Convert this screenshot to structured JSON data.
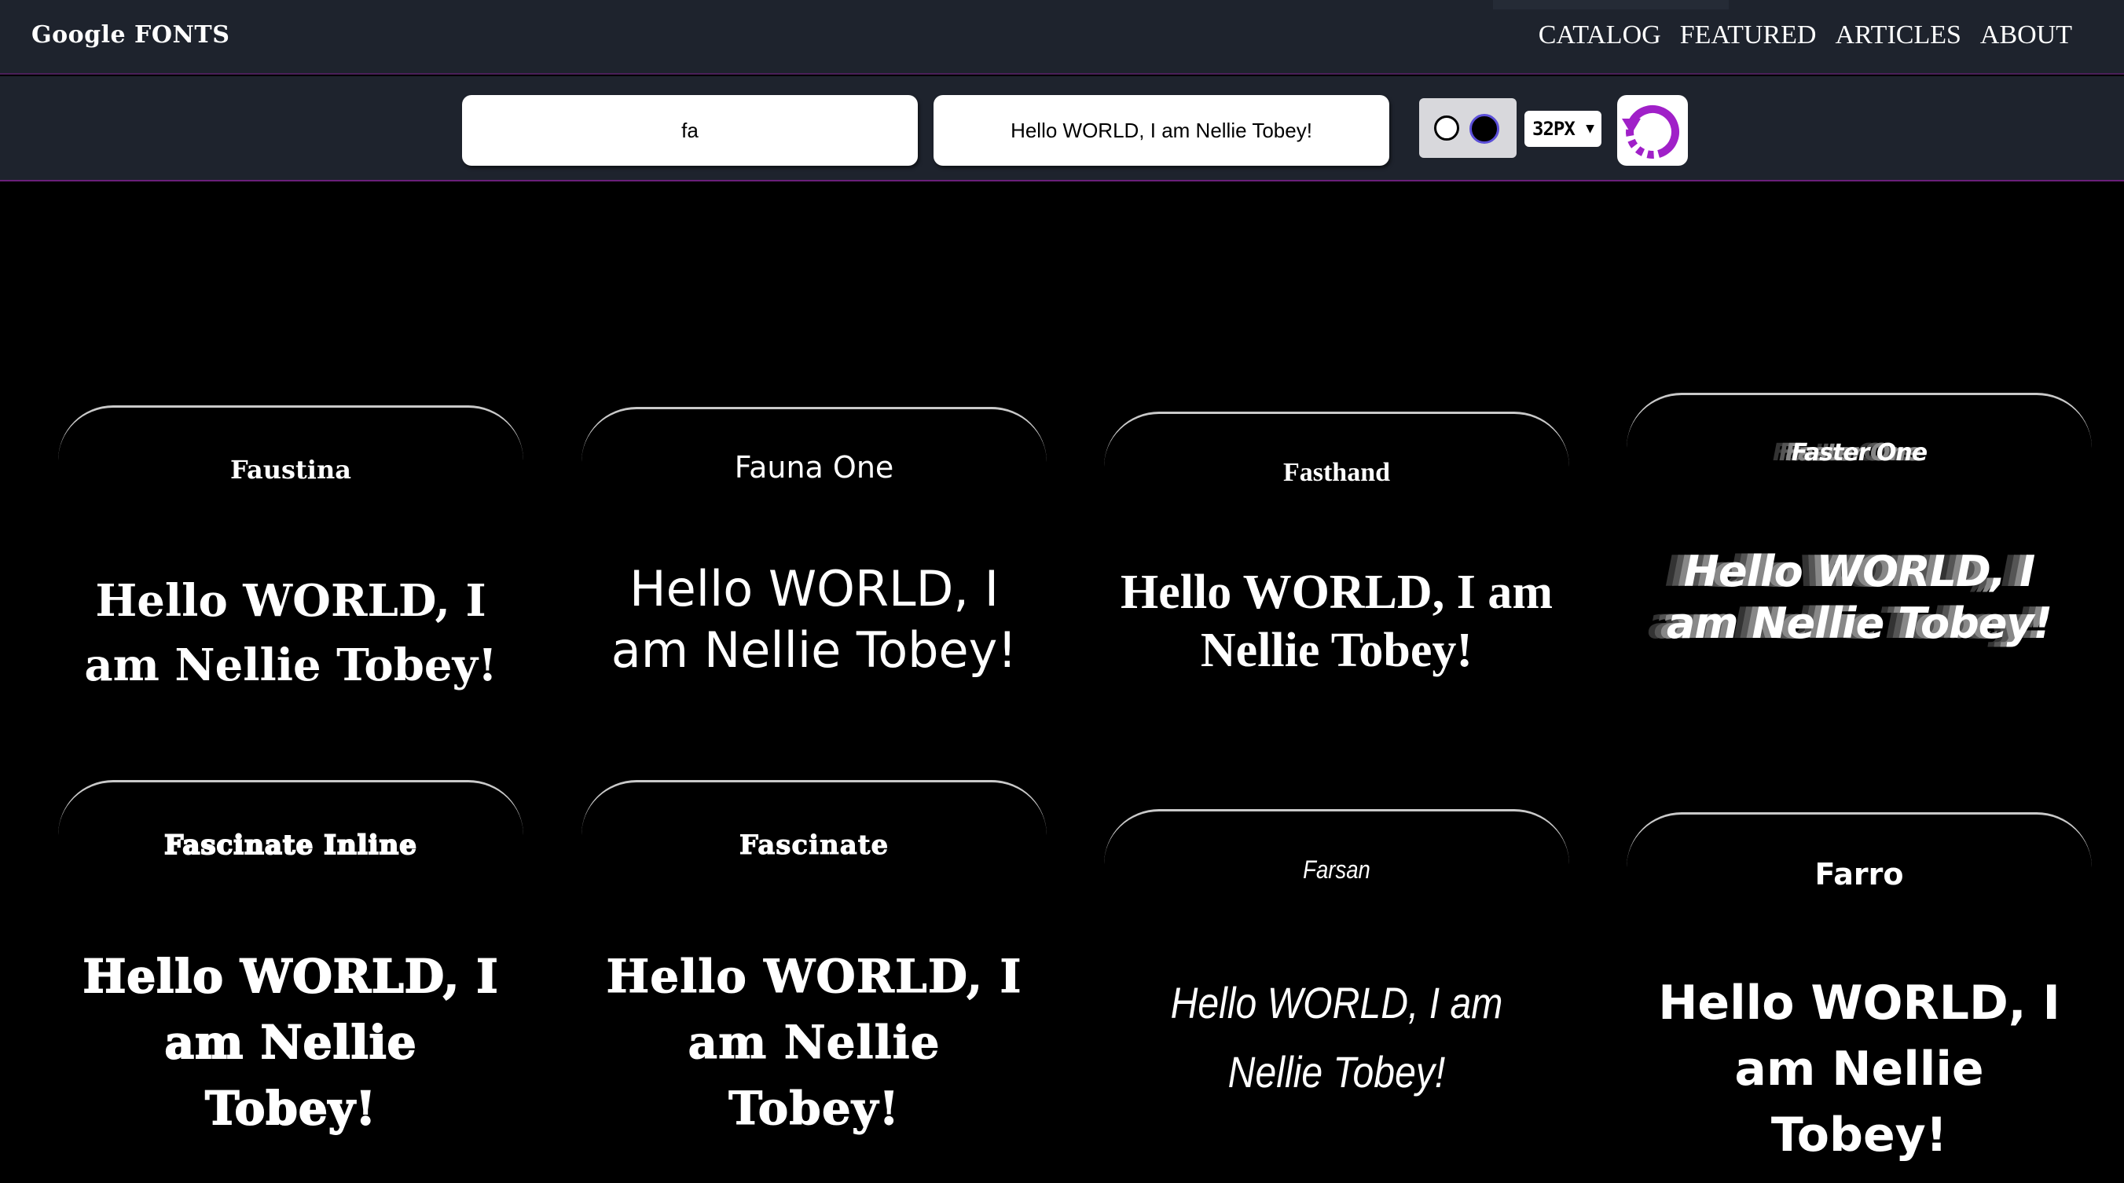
{
  "header": {
    "brand": "Google FONTS",
    "nav": [
      "CATALOG",
      "FEATURED",
      "ARTICLES",
      "ABOUT"
    ]
  },
  "toolbar": {
    "search_value": "fa",
    "preview_value": "Hello WORLD, I am Nellie Tobey!",
    "font_size": "32PX",
    "icons": {
      "theme_light": "light-theme-icon",
      "theme_dark": "dark-theme-icon",
      "size_caret": "chevron-down-icon",
      "reset": "reset-icon"
    }
  },
  "colors": {
    "background": "#000000",
    "header": "#1e232d",
    "accent": "#a020c8",
    "card_border": "#c9c9c9"
  },
  "cards": [
    {
      "name": "Faustina",
      "sample": "Hello WORLD, I am Nellie Tobey!"
    },
    {
      "name": "Fauna One",
      "sample": "Hello WORLD, I am Nellie Tobey!"
    },
    {
      "name": "Fasthand",
      "sample": "Hello WORLD, I am Nellie Tobey!"
    },
    {
      "name": "Faster One",
      "sample": "Hello WORLD, I am Nellie Tobey!"
    },
    {
      "name": "Fascinate Inline",
      "sample": "Hello WORLD, I am Nellie Tobey!"
    },
    {
      "name": "Fascinate",
      "sample": "Hello WORLD, I am Nellie Tobey!"
    },
    {
      "name": "Farsan",
      "sample": "Hello WORLD, I am Nellie Tobey!"
    },
    {
      "name": "Farro",
      "sample": "Hello WORLD, I am Nellie Tobey!"
    }
  ]
}
